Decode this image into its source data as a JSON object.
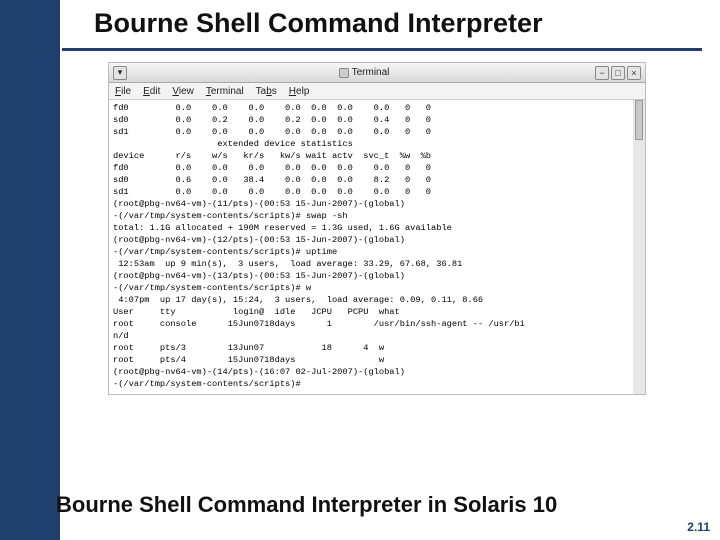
{
  "slide": {
    "title": "Bourne Shell Command Interpreter",
    "caption": "Bourne Shell Command Interpreter in Solaris 10",
    "page_number": "2.11"
  },
  "window": {
    "app_title": "Terminal",
    "menu": {
      "file": "File",
      "edit": "Edit",
      "view": "View",
      "terminal": "Terminal",
      "tabs": "Tabs",
      "help": "Help"
    },
    "buttons": {
      "minimize": "−",
      "maximize": "□",
      "close": "×"
    }
  },
  "terminal_lines": [
    "fd0         0.0    0.0    0.0    0.0  0.0  0.0    0.0   0   0",
    "sd0         0.0    0.2    0.0    0.2  0.0  0.0    0.4   0   0",
    "sd1         0.0    0.0    0.0    0.0  0.0  0.0    0.0   0   0",
    "                    extended device statistics",
    "device      r/s    w/s   kr/s   kw/s wait actv  svc_t  %w  %b",
    "fd0         0.0    0.0    0.0    0.0  0.0  0.0    0.0   0   0",
    "sd0         0.6    0.0   38.4    0.0  0.0  0.0    8.2   0   0",
    "sd1         0.0    0.0    0.0    0.0  0.0  0.0    0.0   0   0",
    "(root@pbg-nv64-vm)-(11/pts)-(00:53 15-Jun-2007)-(global)",
    "-(/var/tmp/system-contents/scripts)# swap -sh",
    "total: 1.1G allocated + 190M reserved = 1.3G used, 1.6G available",
    "(root@pbg-nv64-vm)-(12/pts)-(00:53 15-Jun-2007)-(global)",
    "-(/var/tmp/system-contents/scripts)# uptime",
    " 12:53am  up 9 min(s),  3 users,  load average: 33.29, 67.68, 36.81",
    "(root@pbg-nv64-vm)-(13/pts)-(00:53 15-Jun-2007)-(global)",
    "-(/var/tmp/system-contents/scripts)# w",
    " 4:07pm  up 17 day(s), 15:24,  3 users,  load average: 0.09, 0.11, 8.66",
    "User     tty           login@  idle   JCPU   PCPU  what",
    "root     console      15Jun0718days      1        /usr/bin/ssh-agent -- /usr/bi",
    "n/d",
    "root     pts/3        13Jun07           18      4  w",
    "root     pts/4        15Jun0718days                w",
    "(root@pbg-nv64-vm)-(14/pts)-(16:07 02-Jul-2007)-(global)",
    "-(/var/tmp/system-contents/scripts)#"
  ]
}
